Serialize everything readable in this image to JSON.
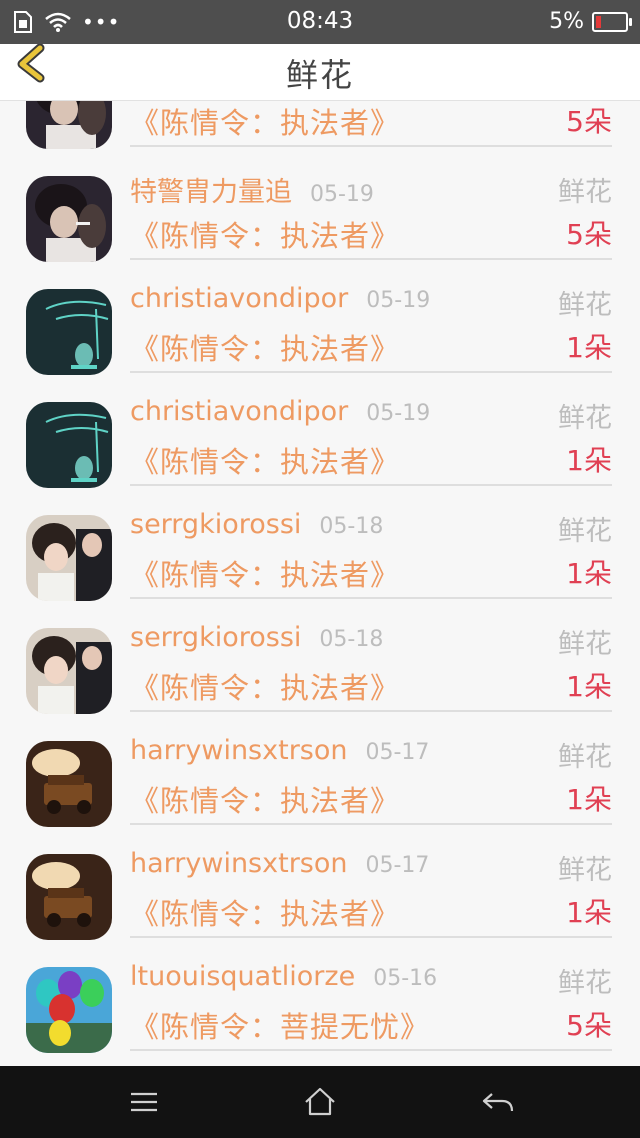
{
  "status": {
    "time": "08:43",
    "battery": "5%"
  },
  "nav": {
    "title": "鲜花"
  },
  "partial_row": {
    "work": "《陈情令：执法者》",
    "count": "5朵"
  },
  "rows": [
    {
      "name": "特警胄力量追",
      "date": "05-19",
      "type": "鲜花",
      "work": "《陈情令：执法者》",
      "count": "5朵",
      "avatar": "avatar-a"
    },
    {
      "name": "christiavondipor",
      "date": "05-19",
      "type": "鲜花",
      "work": "《陈情令：执法者》",
      "count": "1朵",
      "avatar": "avatar-b"
    },
    {
      "name": "christiavondipor",
      "date": "05-19",
      "type": "鲜花",
      "work": "《陈情令：执法者》",
      "count": "1朵",
      "avatar": "avatar-b"
    },
    {
      "name": "serrgkiorossi",
      "date": "05-18",
      "type": "鲜花",
      "work": "《陈情令：执法者》",
      "count": "1朵",
      "avatar": "avatar-c"
    },
    {
      "name": "serrgkiorossi",
      "date": "05-18",
      "type": "鲜花",
      "work": "《陈情令：执法者》",
      "count": "1朵",
      "avatar": "avatar-c"
    },
    {
      "name": "harrywinsxtrson",
      "date": "05-17",
      "type": "鲜花",
      "work": "《陈情令：执法者》",
      "count": "1朵",
      "avatar": "avatar-d"
    },
    {
      "name": "harrywinsxtrson",
      "date": "05-17",
      "type": "鲜花",
      "work": "《陈情令：执法者》",
      "count": "1朵",
      "avatar": "avatar-d"
    },
    {
      "name": "ltuouisquatliorze",
      "date": "05-16",
      "type": "鲜花",
      "work": "《陈情令：菩提无忧》",
      "count": "5朵",
      "avatar": "avatar-e"
    }
  ],
  "colors": {
    "accent": "#ee9a62",
    "count": "#e04053",
    "muted": "#bdbdbd",
    "back_arrow": "#e9c53a"
  },
  "icons": {
    "back": "chevron-left-icon",
    "menu": "menu-icon",
    "home": "home-icon",
    "return": "return-icon"
  }
}
